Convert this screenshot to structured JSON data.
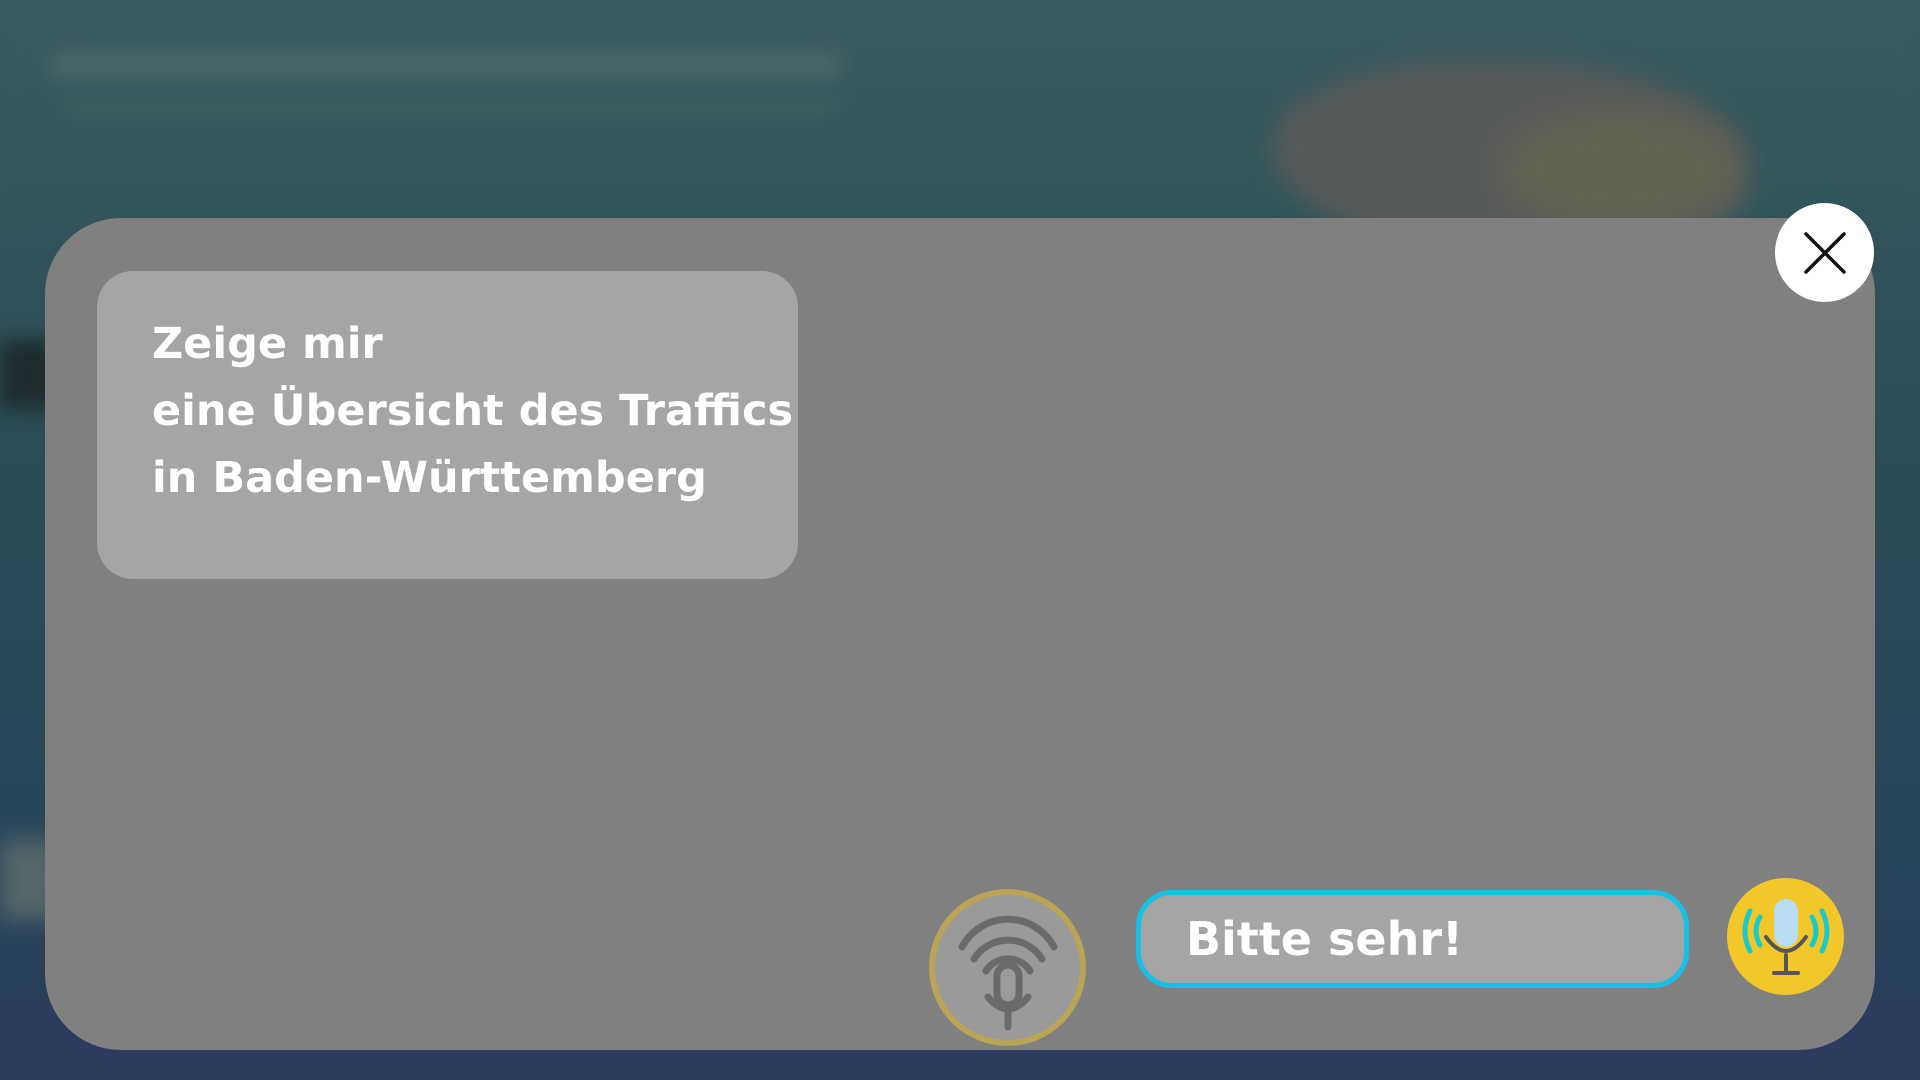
{
  "background": {
    "description_colors": {
      "panel": "#808080",
      "bubble": "#a5a5a5",
      "accent_border": "#16c0e6",
      "voice_button": "#f1c72a",
      "fingerprint_ring": "#b9a458"
    }
  },
  "conversation": {
    "user_message_lines": [
      "Zeige mir",
      "eine Übersicht des Traffics",
      "in Baden-Württemberg"
    ],
    "assistant_reply": "Bitte sehr!"
  },
  "controls": {
    "close_icon": "close-icon",
    "fingerprint_mic_icon": "fingerprint-mic-icon",
    "voice_input_icon": "microphone-waves-icon"
  }
}
